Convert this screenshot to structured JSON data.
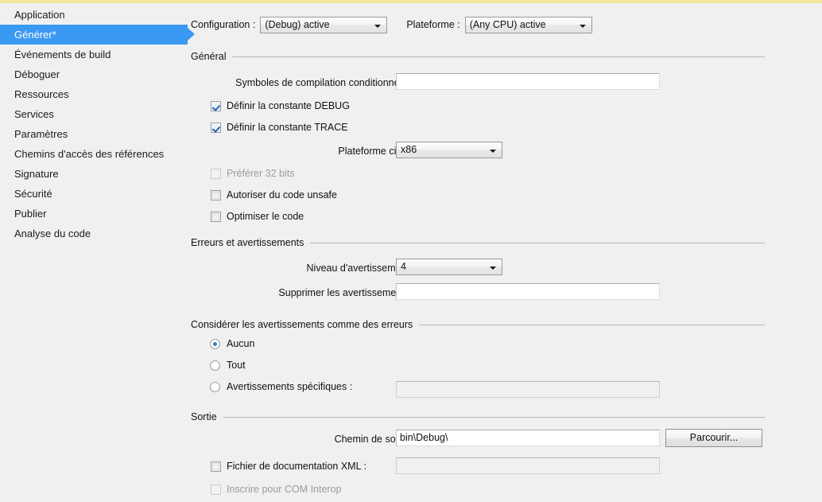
{
  "sidebar": {
    "items": [
      {
        "label": "Application",
        "selected": false
      },
      {
        "label": "Générer*",
        "selected": true
      },
      {
        "label": "Événements de build",
        "selected": false
      },
      {
        "label": "Déboguer",
        "selected": false
      },
      {
        "label": "Ressources",
        "selected": false
      },
      {
        "label": "Services",
        "selected": false
      },
      {
        "label": "Paramètres",
        "selected": false
      },
      {
        "label": "Chemins d'accès des références",
        "selected": false
      },
      {
        "label": "Signature",
        "selected": false
      },
      {
        "label": "Sécurité",
        "selected": false
      },
      {
        "label": "Publier",
        "selected": false
      },
      {
        "label": "Analyse du code",
        "selected": false
      }
    ],
    "selected_color": "#3a99f2"
  },
  "toolbar": {
    "configuration_label": "Configuration :",
    "configuration_value": "(Debug) active",
    "platform_label": "Plateforme :",
    "platform_value": "(Any CPU) active"
  },
  "general": {
    "title": "Général",
    "conditional_symbols_label": "Symboles de compilation conditionnelle :",
    "conditional_symbols_value": "",
    "define_debug_label": "Définir la constante DEBUG",
    "define_debug_checked": true,
    "define_trace_label": "Définir la constante TRACE",
    "define_trace_checked": true,
    "target_platform_label": "Plateforme cible :",
    "target_platform_value": "x86",
    "prefer_32bit_label": "Préférer 32 bits",
    "prefer_32bit_checked": false,
    "prefer_32bit_disabled": true,
    "allow_unsafe_label": "Autoriser du code unsafe",
    "allow_unsafe_checked": false,
    "optimize_label": "Optimiser le code",
    "optimize_checked": false
  },
  "errors": {
    "title": "Erreurs et avertissements",
    "warning_level_label": "Niveau d'avertissement :",
    "warning_level_value": "4",
    "suppress_warnings_label": "Supprimer les avertissements :",
    "suppress_warnings_value": ""
  },
  "warnings_as_errors": {
    "title": "Considérer les avertissements comme des erreurs",
    "options": [
      {
        "label": "Aucun",
        "selected": true
      },
      {
        "label": "Tout",
        "selected": false
      },
      {
        "label": "Avertissements spécifiques :",
        "selected": false
      }
    ],
    "specific_value": ""
  },
  "output": {
    "title": "Sortie",
    "output_path_label": "Chemin de sortie :",
    "output_path_value": "bin\\Debug\\",
    "browse_label": "Parcourir...",
    "xml_doc_label": "Fichier de documentation XML :",
    "xml_doc_checked": false,
    "xml_doc_value": "",
    "com_interop_label": "Inscrire pour COM Interop",
    "com_interop_checked": false,
    "com_interop_disabled": true
  }
}
